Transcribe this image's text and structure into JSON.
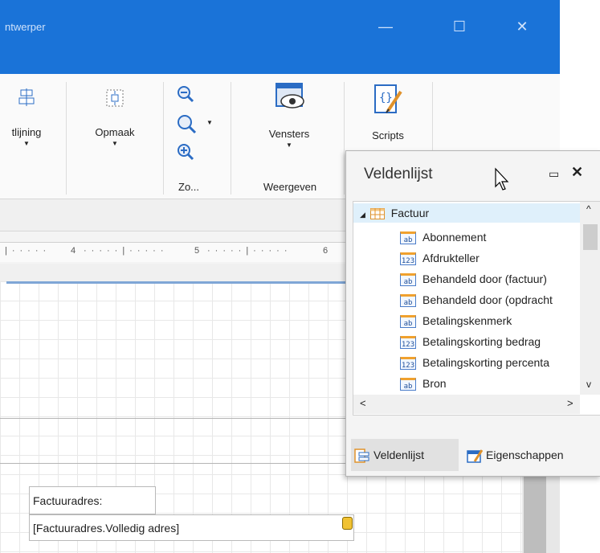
{
  "window": {
    "title": "ntwerper",
    "minimize_symbol": "—",
    "maximize_symbol": "☐",
    "close_symbol": "✕"
  },
  "ribbon": {
    "buttons": [
      {
        "label": "tlijning",
        "icon": "align-icon",
        "has_dropdown": true
      },
      {
        "label": "Opmaak",
        "icon": "format-icon",
        "has_dropdown": true
      },
      {
        "label": "Vensters",
        "icon": "windows-eye-icon",
        "has_dropdown": true
      },
      {
        "label": "Scripts",
        "icon": "scripts-icon",
        "has_dropdown": false
      }
    ],
    "zoom_icons": [
      "zoom-out-icon",
      "zoom-icon",
      "zoom-in-icon"
    ],
    "groups": {
      "zoom": "Zo...",
      "view": "Weergeven"
    }
  },
  "ruler": {
    "marks": [
      "4",
      "5",
      "6"
    ]
  },
  "report": {
    "label_text": "Factuuradres:",
    "value_text": "[Factuuradres.Volledig adres]"
  },
  "field_list_panel": {
    "title": "Veldenlijst",
    "pin_symbol": "▭",
    "close_symbol": "✕",
    "root": {
      "label": "Factuur",
      "icon": "table-icon",
      "expanded_symbol": "◢"
    },
    "items": [
      {
        "label": "Abonnement",
        "type": "ab"
      },
      {
        "label": "Afdrukteller",
        "type": "123"
      },
      {
        "label": "Behandeld door (factuur)",
        "type": "ab"
      },
      {
        "label": "Behandeld door (opdracht",
        "type": "ab"
      },
      {
        "label": "Betalingskenmerk",
        "type": "ab"
      },
      {
        "label": "Betalingskorting bedrag",
        "type": "123"
      },
      {
        "label": "Betalingskorting percenta",
        "type": "123"
      },
      {
        "label": "Bron",
        "type": "ab"
      }
    ],
    "scroll": {
      "up": "^",
      "down": "v",
      "left": "<",
      "right": ">"
    },
    "tabs": [
      {
        "label": "Veldenlijst",
        "icon": "field-list-icon",
        "active": true
      },
      {
        "label": "Eigenschappen",
        "icon": "properties-icon",
        "active": false
      }
    ]
  }
}
